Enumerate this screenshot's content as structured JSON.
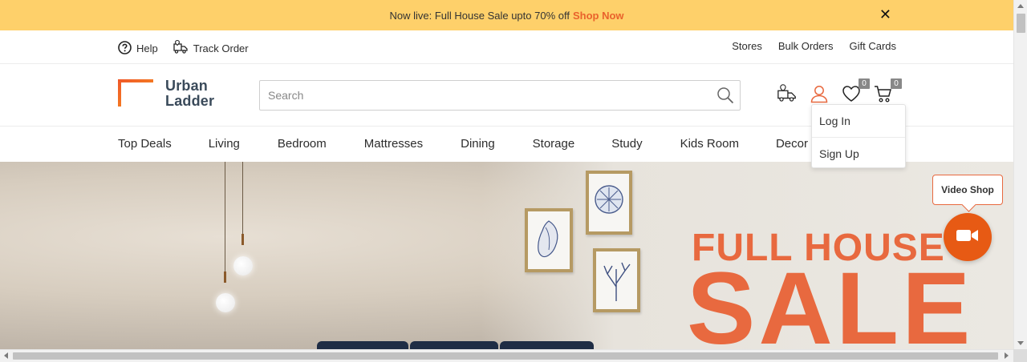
{
  "announcement": {
    "text": "Now live: Full House Sale upto 70% off",
    "link": "Shop Now",
    "close": "✕"
  },
  "utility": {
    "help": "Help",
    "track_order": "Track Order",
    "stores": "Stores",
    "bulk_orders": "Bulk Orders",
    "gift_cards": "Gift Cards"
  },
  "header": {
    "logo_line1": "Urban",
    "logo_line2": "Ladder",
    "search_placeholder": "Search",
    "wishlist_count": "0",
    "cart_count": "0"
  },
  "nav": {
    "items": [
      "Top Deals",
      "Living",
      "Bedroom",
      "Mattresses",
      "Dining",
      "Storage",
      "Study",
      "Kids Room",
      "Decor"
    ]
  },
  "account_menu": {
    "login": "Log In",
    "signup": "Sign Up"
  },
  "hero": {
    "headline_top": "FULL HOUSE",
    "headline_big": "SALE"
  },
  "video_shop": {
    "label": "Video Shop"
  },
  "colors": {
    "announce_bg": "#fed06a",
    "accent": "#e8693f",
    "video_button": "#e75a14"
  }
}
